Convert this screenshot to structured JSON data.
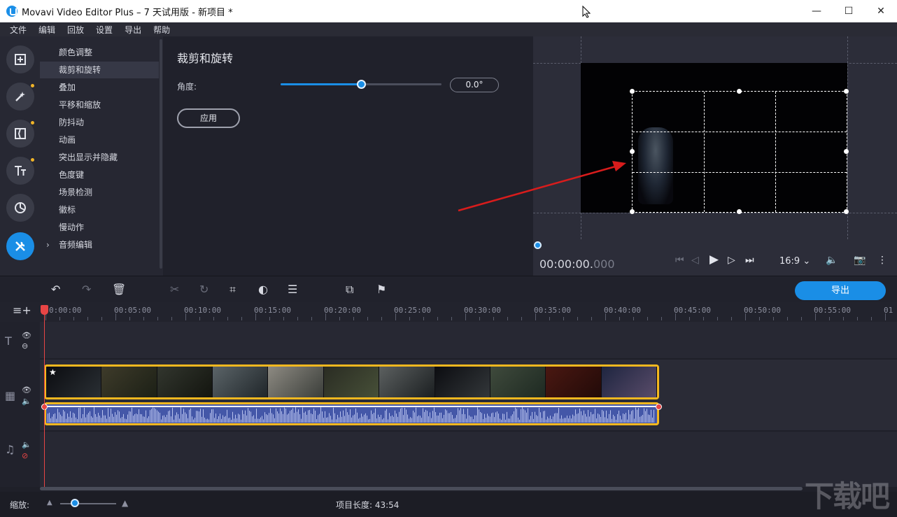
{
  "window": {
    "title": "Movavi Video Editor Plus – 7 天试用版 - 新项目 *",
    "minimize": "—",
    "maximize": "☐",
    "close": "✕"
  },
  "menu": [
    "文件",
    "编辑",
    "回放",
    "设置",
    "导出",
    "帮助"
  ],
  "rail": [
    {
      "icon": "import-icon",
      "glyph": "⊞",
      "dot": false
    },
    {
      "icon": "magic-wand-icon",
      "glyph": "✦",
      "dot": true
    },
    {
      "icon": "transitions-icon",
      "glyph": "◫",
      "dot": true
    },
    {
      "icon": "titles-icon",
      "glyph": "Tт",
      "dot": true
    },
    {
      "icon": "stickers-icon",
      "glyph": "◔",
      "dot": false
    },
    {
      "icon": "tools-icon",
      "glyph": "✕",
      "dot": false
    }
  ],
  "tools": {
    "items": [
      "颜色调整",
      "裁剪和旋转",
      "叠加",
      "平移和缩放",
      "防抖动",
      "动画",
      "突出显示并隐藏",
      "色度键",
      "场景检测",
      "徽标",
      "慢动作",
      "音频编辑"
    ],
    "active_index": 1
  },
  "props": {
    "title": "裁剪和旋转",
    "angle_label": "角度:",
    "angle_value": "0.0°",
    "angle_slider_fraction": 0.5,
    "apply_label": "应用"
  },
  "preview": {
    "timecode_main": "00:00:00.",
    "timecode_ms": "000",
    "aspect_ratio": "16:9 ⌄"
  },
  "timeline": {
    "export_label": "导出",
    "ruler": [
      "0:00:00",
      "00:05:00",
      "00:10:00",
      "00:15:00",
      "00:20:00",
      "00:25:00",
      "00:30:00",
      "00:35:00",
      "00:40:00",
      "00:45:00",
      "00:50:00",
      "00:55:00",
      "01"
    ]
  },
  "status": {
    "zoom_label": "缩放:",
    "project_length": "项目长度:  43:54"
  },
  "watermark": "下载吧",
  "colors": {
    "accent": "#1a8ee6",
    "clip_border": "#f5b81f",
    "playhead": "#e84545",
    "audio": "#4457a8"
  }
}
